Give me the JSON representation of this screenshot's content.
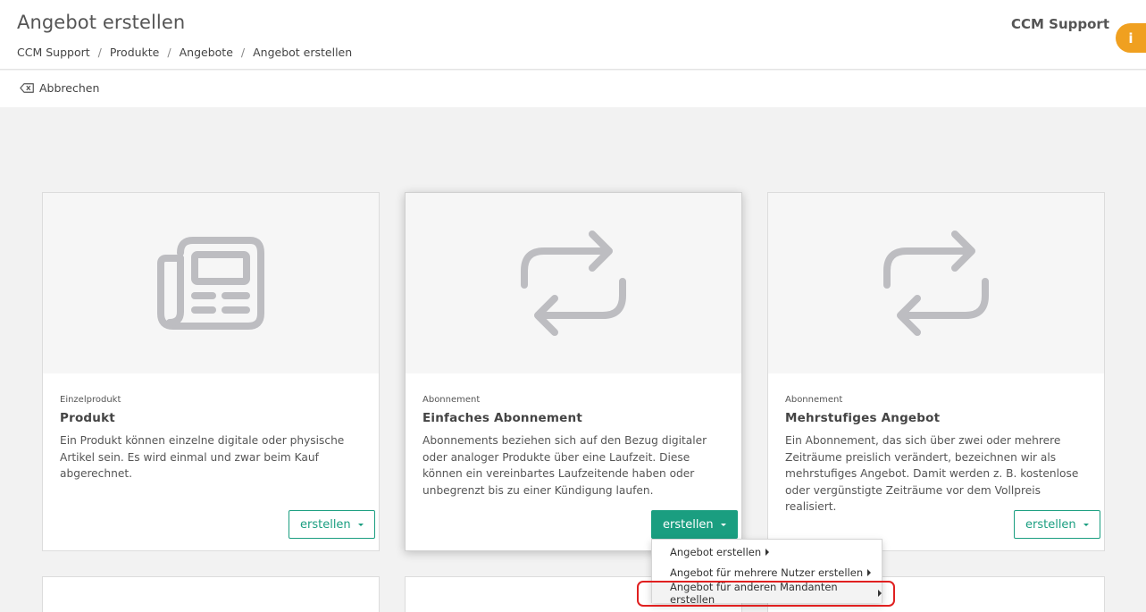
{
  "header": {
    "title": "Angebot erstellen",
    "user": "CCM Support",
    "info_icon": "i",
    "breadcrumb": [
      "CCM Support",
      "Produkte",
      "Angebote",
      "Angebot erstellen"
    ],
    "separator": "/"
  },
  "toolbar": {
    "cancel_label": "Abbrechen",
    "cancel_icon": "backspace-icon"
  },
  "cards": [
    {
      "icon": "newspaper-icon",
      "category": "Einzelprodukt",
      "title": "Produkt",
      "description": "Ein Produkt können einzelne digitale oder physische Artikel sein. Es wird einmal und zwar beim Kauf abgerechnet.",
      "button": "erstellen"
    },
    {
      "icon": "repeat-arrows-icon",
      "category": "Abonnement",
      "title": "Einfaches Abonnement",
      "description": "Abonnements beziehen sich auf den Bezug digitaler oder analoger Produkte über eine Laufzeit. Diese können ein vereinbartes Laufzeitende haben oder unbegrenzt bis zu einer Kündigung laufen.",
      "button": "erstellen"
    },
    {
      "icon": "repeat-arrows-icon",
      "category": "Abonnement",
      "title": "Mehrstufiges Angebot",
      "description": "Ein Abonnement, das sich über zwei oder mehrere Zeiträume preislich verändert, bezeichnen wir als mehrstufiges Angebot. Damit werden z. B. kostenlose oder vergünstigte Zeiträume vor dem Vollpreis realisiert.",
      "button": "erstellen"
    }
  ],
  "dropdown": {
    "items": [
      "Angebot erstellen",
      "Angebot für mehrere Nutzer erstellen",
      "Angebot für anderen Mandanten erstellen"
    ]
  },
  "colors": {
    "accent": "#1a9e80",
    "info": "#f0a020",
    "highlight": "#e02020",
    "icon_gray": "#bdbdc1"
  }
}
